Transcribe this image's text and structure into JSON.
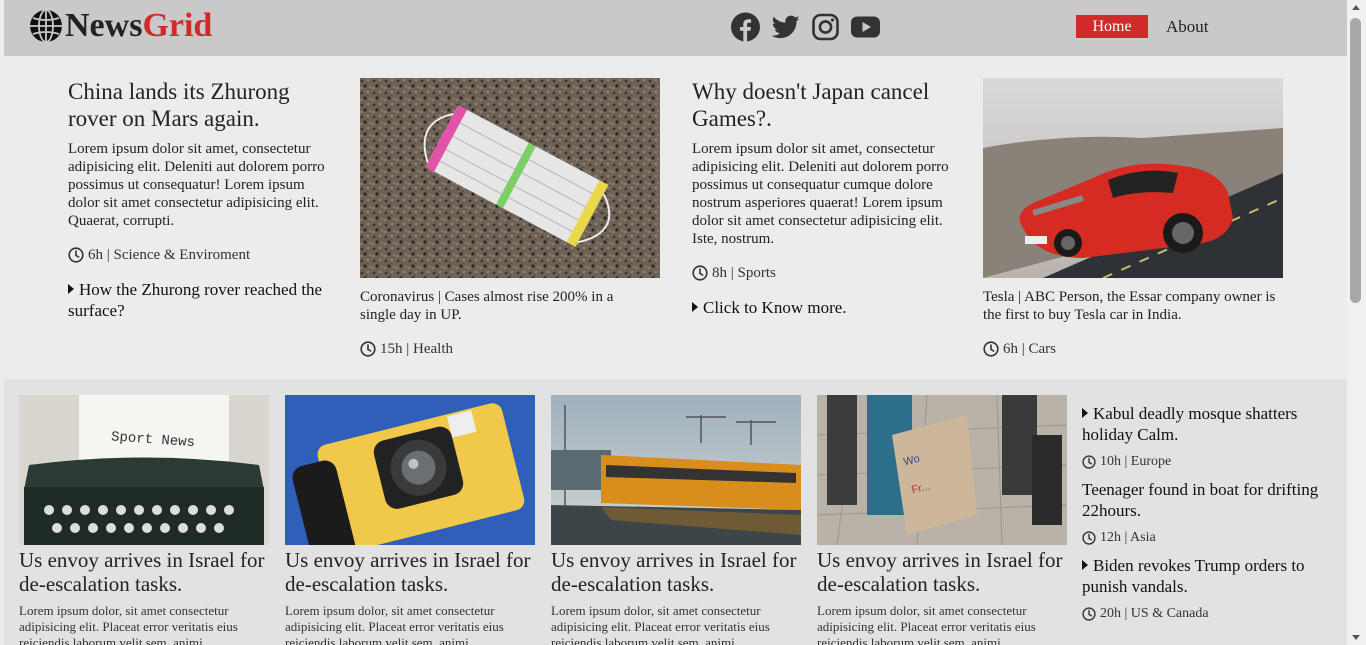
{
  "header": {
    "logo_part1": "News",
    "logo_part2": "Grid",
    "accent_color": "#d12a2a",
    "social": [
      "facebook-icon",
      "twitter-icon",
      "instagram-icon",
      "youtube-icon"
    ],
    "nav": {
      "home": "Home",
      "about": "About"
    }
  },
  "top": {
    "a1": {
      "title": "China lands its Zhurong rover on Mars again.",
      "body": "Lorem ipsum dolor sit amet, consectetur adipisicing elit. Deleniti aut dolorem porro possimus ut consequatur! Lorem ipsum dolor sit amet consectetur adipisicing elit. Quaerat, corrupti.",
      "meta": "6h | Science & Enviroment",
      "link": "How the Zhurong rover reached the surface?"
    },
    "a2": {
      "caption": "Coronavirus | Cases almost rise 200% in a single day in UP.",
      "meta": "15h | Health"
    },
    "a3": {
      "title": "Why doesn't Japan cancel Games?.",
      "body": "Lorem ipsum dolor sit amet, consectetur adipisicing elit. Deleniti aut dolorem porro possimus ut consequatur cumque dolore nostrum asperiores quaerat! Lorem ipsum dolor sit amet consectetur adipisicing elit. Iste, nostrum.",
      "meta": "8h | Sports",
      "link": "Click to Know more."
    },
    "a4": {
      "caption": "Tesla | ABC Person, the Essar company owner is the first to buy Tesla car in India.",
      "meta": "6h | Cars"
    }
  },
  "cards": [
    {
      "title": "Us envoy arrives in Israel for de-escalation tasks.",
      "body": "Lorem ipsum dolor, sit amet consectetur adipisicing elit. Placeat error veritatis eius reiciendis laborum velit sem, animi",
      "image_text": "Sport News"
    },
    {
      "title": "Us envoy arrives in Israel for de-escalation tasks.",
      "body": "Lorem ipsum dolor, sit amet consectetur adipisicing elit. Placeat error veritatis eius reiciendis laborum velit sem, animi"
    },
    {
      "title": "Us envoy arrives in Israel for de-escalation tasks.",
      "body": "Lorem ipsum dolor, sit amet consectetur adipisicing elit. Placeat error veritatis eius reiciendis laborum velit sem, animi"
    },
    {
      "title": "Us envoy arrives in Israel for de-escalation tasks.",
      "body": "Lorem ipsum dolor, sit amet consectetur adipisicing elit. Placeat error veritatis eius reiciendis laborum velit sem, animi"
    }
  ],
  "side": [
    {
      "title": "Kabul deadly mosque shatters holiday Calm.",
      "meta": "10h | Europe"
    },
    {
      "title": "Teenager found in boat for drifting 22hours.",
      "meta": "12h | Asia"
    },
    {
      "title": "Biden revokes Trump orders to punish vandals.",
      "meta": "20h | US & Canada"
    }
  ]
}
